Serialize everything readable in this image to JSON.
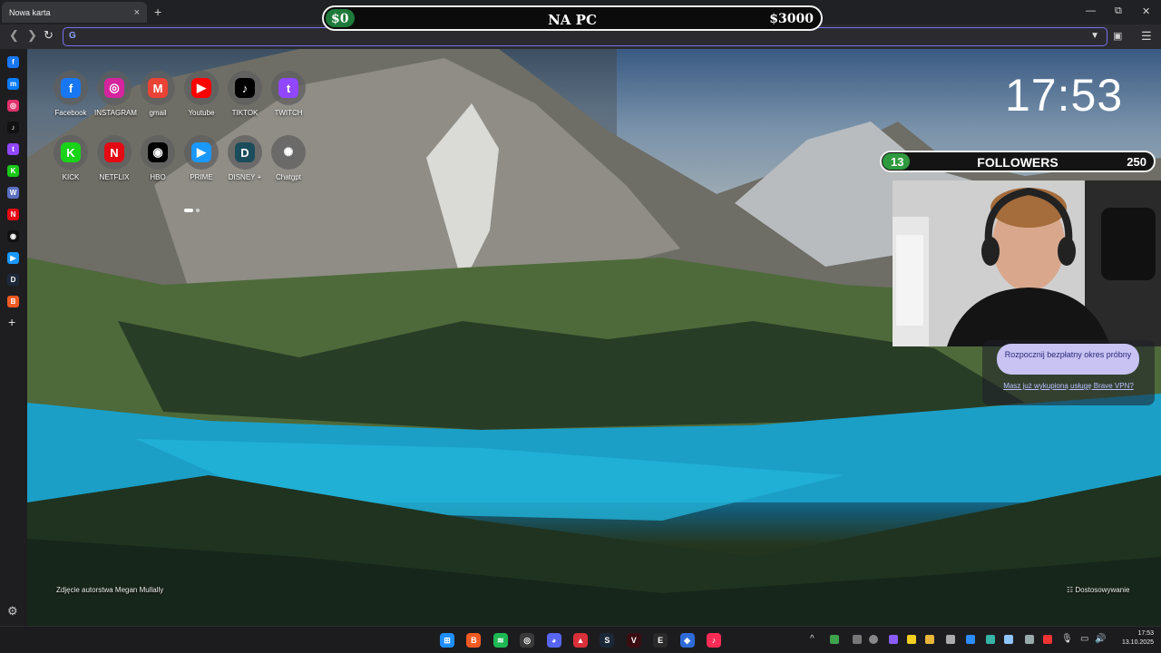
{
  "browser": {
    "tab_title": "Nowa karta",
    "tab_close": "×",
    "new_tab": "+",
    "address_value": "",
    "search_engine_icon": "G"
  },
  "window_controls": {
    "minimize": "—",
    "maximize": "⧉",
    "close": "✕"
  },
  "goal_bar": {
    "current": "$0",
    "title": "NA PC",
    "target": "$3000",
    "progress": 0
  },
  "sidebar": {
    "items": [
      {
        "icon": "facebook-icon",
        "glyph": "f",
        "color": "#1877f2"
      },
      {
        "icon": "messenger-icon",
        "glyph": "m",
        "color": "#0a7cff"
      },
      {
        "icon": "instagram-icon",
        "glyph": "◎",
        "color": "#e1306c"
      },
      {
        "icon": "tiktok-icon",
        "glyph": "♪",
        "color": "#111111"
      },
      {
        "icon": "twitch-icon",
        "glyph": "t",
        "color": "#9146ff"
      },
      {
        "icon": "kick-icon",
        "glyph": "K",
        "color": "#18c917"
      },
      {
        "icon": "wikipedia-icon",
        "glyph": "W",
        "color": "#5a6fc0"
      },
      {
        "icon": "netflix-icon",
        "glyph": "N",
        "color": "#e50914"
      },
      {
        "icon": "hbo-icon",
        "glyph": "◉",
        "color": "#111111"
      },
      {
        "icon": "prime-icon",
        "glyph": "▶",
        "color": "#1a98ff"
      },
      {
        "icon": "disney-icon",
        "glyph": "D",
        "color": "#1e2a3a"
      },
      {
        "icon": "brave-news-icon",
        "glyph": "B",
        "color": "#f15a22"
      }
    ],
    "add": "+",
    "settings": "⚙"
  },
  "speed_dial": [
    {
      "label": "Facebook",
      "glyph": "f",
      "color": "#1877f2",
      "icon": "facebook-icon"
    },
    {
      "label": "INSTAGRAM",
      "glyph": "◎",
      "color": "#d6249f",
      "icon": "instagram-icon"
    },
    {
      "label": "gmail",
      "glyph": "M",
      "color": "#ea4335",
      "icon": "gmail-icon"
    },
    {
      "label": "Youtube",
      "glyph": "▶",
      "color": "#ff0000",
      "icon": "youtube-icon"
    },
    {
      "label": "TIKTOK",
      "glyph": "♪",
      "color": "#000000",
      "icon": "tiktok-icon"
    },
    {
      "label": "TWITCH",
      "glyph": "t",
      "color": "#9146ff",
      "icon": "twitch-icon"
    },
    {
      "label": "KICK",
      "glyph": "K",
      "color": "#19d319",
      "icon": "kick-icon"
    },
    {
      "label": "NETFLIX",
      "glyph": "N",
      "color": "#e50914",
      "icon": "netflix-icon"
    },
    {
      "label": "HBO",
      "glyph": "◉",
      "color": "#000000",
      "icon": "hbo-icon"
    },
    {
      "label": "PRIME",
      "glyph": "▶",
      "color": "#1a98ff",
      "icon": "prime-icon"
    },
    {
      "label": "DISNEY +",
      "glyph": "D",
      "color": "#1b4c5c",
      "icon": "disney-icon"
    },
    {
      "label": "Chatgpt",
      "glyph": "✺",
      "color": "#6a6a6a",
      "icon": "chatgpt-icon"
    }
  ],
  "clock": "17:53",
  "followers": {
    "count": "13",
    "label": "FOLLOWERS",
    "goal": "250"
  },
  "vpn": {
    "cta": "Rozpocznij bezpłatny okres próbny",
    "link": "Masz już wykupioną usługę Brave VPN?"
  },
  "photo_credit": "Zdjęcie autorstwa Megan Mullally",
  "customize": "Dostosowywanie",
  "taskbar": {
    "apps": [
      {
        "icon": "windows-start-icon",
        "glyph": "⊞",
        "color": "#1f8fff"
      },
      {
        "icon": "brave-icon",
        "glyph": "B",
        "color": "#f15a22"
      },
      {
        "icon": "spotify-icon",
        "glyph": "≋",
        "color": "#1db954"
      },
      {
        "icon": "obs-icon",
        "glyph": "◎",
        "color": "#3a3a3a"
      },
      {
        "icon": "discord-icon",
        "glyph": "◕",
        "color": "#5865f2"
      },
      {
        "icon": "app-red-icon",
        "glyph": "▲",
        "color": "#d9303a"
      },
      {
        "icon": "steam-icon",
        "glyph": "S",
        "color": "#1b2838"
      },
      {
        "icon": "valorant-icon",
        "glyph": "V",
        "color": "#3a0d12"
      },
      {
        "icon": "epic-games-icon",
        "glyph": "E",
        "color": "#2a2a2a"
      },
      {
        "icon": "blue-app-icon",
        "glyph": "◆",
        "color": "#2f6bd8"
      },
      {
        "icon": "tiktok-live-icon",
        "glyph": "♪",
        "color": "#fe2c55"
      }
    ],
    "tray_chevron": "^",
    "date_time": {
      "time": "17:53",
      "date": "13.10.2025"
    }
  }
}
